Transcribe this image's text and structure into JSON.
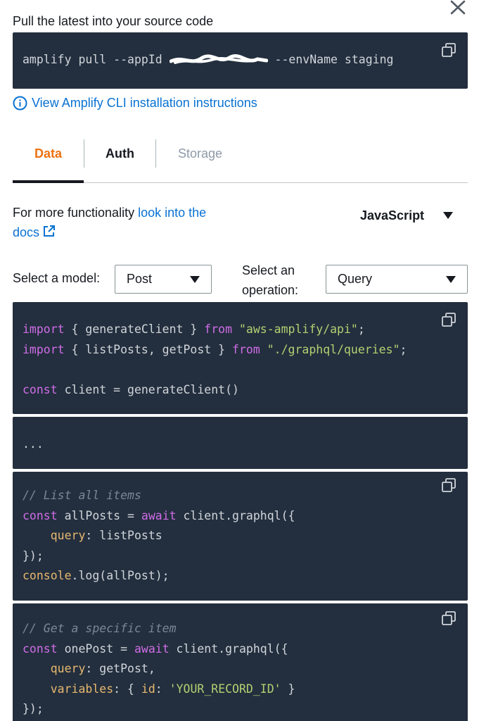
{
  "header": {
    "close_icon": "close-icon",
    "pull_title": "Pull the latest into your source code"
  },
  "pull_command": {
    "prefix": "amplify pull --appId ",
    "suffix": " --envName staging",
    "copy_icon": "copy-icon"
  },
  "cli_link": {
    "icon": "info-icon",
    "label": "View Amplify CLI installation instructions"
  },
  "tabs": [
    {
      "label": "Data",
      "state": "active"
    },
    {
      "label": "Auth",
      "state": "normal"
    },
    {
      "label": "Storage",
      "state": "disabled"
    }
  ],
  "functionality": {
    "text": "For more functionality ",
    "link_label": "look into the docs",
    "link_icon": "external-link-icon"
  },
  "language": {
    "selected": "JavaScript"
  },
  "model_select": {
    "label": "Select a model:",
    "value": "Post"
  },
  "operation_select": {
    "label": "Select an operation:",
    "value": "Query"
  },
  "code": {
    "block1": {
      "l1": [
        "import",
        " { generateClient } ",
        "from",
        " ",
        "\"aws-amplify/api\"",
        ";"
      ],
      "l2": [
        "import",
        " { listPosts, getPost } ",
        "from",
        " ",
        "\"./graphql/queries\"",
        ";"
      ],
      "l3": [
        "const",
        " client = generateClient()"
      ]
    },
    "block2": {
      "l1": "..."
    },
    "block3": {
      "comment": "// List all items",
      "l1": [
        "const",
        " allPosts = ",
        "await",
        " client.graphql({"
      ],
      "l2": [
        "    ",
        "query",
        ": listPosts"
      ],
      "l3": "});",
      "l4": [
        "console",
        ".log(allPost);"
      ]
    },
    "block4": {
      "comment": "// Get a specific item",
      "l1": [
        "const",
        " onePost = ",
        "await",
        " client.graphql({"
      ],
      "l2": [
        "    ",
        "query",
        ": getPost,"
      ],
      "l3": [
        "    ",
        "variables",
        ": { ",
        "id",
        ": ",
        "'YOUR_RECORD_ID'",
        " }"
      ],
      "l4": "});"
    }
  },
  "colors": {
    "code_bg": "#232f3e",
    "link": "#0972d3",
    "active_tab": "#ec7211",
    "keyword": "#d16ce8",
    "string": "#b5cf72",
    "property": "#e8b870",
    "comment": "#7b8794"
  }
}
